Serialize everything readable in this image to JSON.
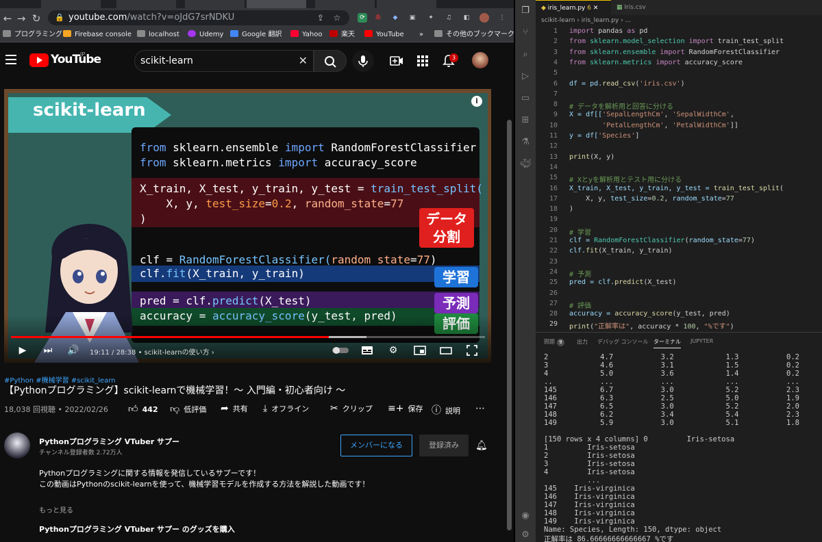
{
  "browser": {
    "url_host": "youtube.com",
    "url_path": "/watch?v=oJdG7srNDKU",
    "bookmarks": [
      {
        "label": "プログラミング",
        "color": "#8a8a8a"
      },
      {
        "label": "Firebase console",
        "color": "#f6a623"
      },
      {
        "label": "localhost",
        "color": "#8a8a8a"
      },
      {
        "label": "Udemy",
        "color": "#a435f0"
      },
      {
        "label": "Google 翻訳",
        "color": "#4285f4"
      },
      {
        "label": "Yahoo",
        "color": "#ff0033"
      },
      {
        "label": "楽天",
        "color": "#bf0000"
      },
      {
        "label": "YouTube",
        "color": "#ff0000"
      },
      {
        "label": "»",
        "color": ""
      },
      {
        "label": "その他のブックマーク",
        "color": "#8a8a8a"
      }
    ]
  },
  "youtube": {
    "logo_text": "YouTube",
    "logo_region": "JP",
    "search_value": "scikit-learn",
    "notification_count": "3",
    "video": {
      "banner": "scikit-learn",
      "code_lines": {
        "l1a": "from",
        "l1b": " sklearn.ensemble ",
        "l1c": "import",
        "l1d": " RandomForestClassifier",
        "l2a": "from",
        "l2b": " sklearn.metrics ",
        "l2c": "import",
        "l2d": " accuracy_score",
        "l3a": "X_train, X_test, y_train, y_test = ",
        "l3b": "train_test_split(",
        "l4a": "    X, y, ",
        "l4b": "test_size",
        "l4c": "=",
        "l4d": "0.2",
        "l4e": ", ",
        "l4f": "random_state",
        "l4g": "=",
        "l4h": "77",
        "l5": ")",
        "l6a": "clf = ",
        "l6b": "RandomForestClassifier(",
        "l6c": "random_state",
        "l6d": "=",
        "l6e": "77",
        "l6f": ")",
        "l7a": "clf.",
        "l7b": "fit",
        "l7c": "(X_train, y_train)",
        "l8a": "pred = clf.",
        "l8b": "predict",
        "l8c": "(X_test)",
        "l9a": "accuracy = ",
        "l9b": "accuracy_score",
        "l9c": "(y_test, pred)"
      },
      "tags": {
        "split1": "データ",
        "split2": "分割",
        "learn": "学習",
        "predict": "予測",
        "evaluate": "評価"
      },
      "current_time": "19:11",
      "duration": "28:38",
      "chapter": "scikit-learnの使い方",
      "played_fraction": 0.67
    },
    "hashtags": "#Python #機械学習 #scikit_learn",
    "title": "【Pythonプログラミング】scikit-learnで機械学習！〜 入門編・初心者向け 〜",
    "views": "18,038 回視聴",
    "date": "2022/02/26",
    "actions": {
      "likes": "442",
      "dislike": "低評価",
      "share": "共有",
      "offline": "オフライン",
      "clip": "クリップ",
      "save": "保存",
      "explain": "説明"
    },
    "channel": {
      "name": "Pythonプログラミング VTuber サプー",
      "subscribers": "チャンネル登録者数 2.72万人",
      "join": "メンバーになる",
      "subscribed": "登録済み"
    },
    "description": [
      "Pythonプログラミングに関する情報を発信しているサプーです！",
      "この動画はPythonのscikit-learnを使って、機械学習モデルを作成する方法を解説した動画です！"
    ],
    "show_more": "もっと見る",
    "merch": "Pythonプログラミング VTuber サプー のグッズを購入"
  },
  "vscode": {
    "tabs": [
      {
        "label": "iris_learn.py",
        "badge": "6",
        "active": true
      },
      {
        "label": "Iris.csv",
        "active": false
      }
    ],
    "breadcrumb": "scikit-learn  ›  iris_learn.py  ›  ...",
    "code": {
      "1a": "import",
      "1b": " pandas ",
      "1c": "as",
      "1d": " pd",
      "2a": "from",
      "2b": " sklearn.model_selection ",
      "2c": "import",
      "2d": " train_test_split",
      "3a": "from",
      "3b": " sklearn.ensemble ",
      "3c": "import",
      "3d": " RandomForestClassifier",
      "4a": "from",
      "4b": " sklearn.metrics ",
      "4c": "import",
      "4d": " accuracy_score",
      "6a": "df = pd.",
      "6b": "read_csv",
      "6c": "(",
      "6d": "'iris.csv'",
      "6e": ")",
      "8": "# データを解析用と回答に分ける",
      "9a": "X = df[[",
      "9b": "'SepalLengthCm'",
      "9c": ", ",
      "9d": "'SepalWidthCm'",
      "9e": ",",
      "10a": "        ",
      "10b": "'PetalLengthCm'",
      "10c": ", ",
      "10d": "'PetalWidthCm'",
      "10e": "]]",
      "11a": "y = df[",
      "11b": "'Species'",
      "11c": "]",
      "13a": "print",
      "13b": "(X, y)",
      "15": "# Xとyを解析用とテスト用に分ける",
      "16a": "X_train, X_test, y_train, y_test = ",
      "16b": "train_test_split",
      "16c": "(",
      "17a": "    X, y, ",
      "17b": "test_size",
      "17c": "=",
      "17d": "0.2",
      "17e": ", ",
      "17f": "random_state",
      "17g": "=",
      "17h": "77",
      "18": ")",
      "20": "# 学習",
      "21a": "clf = ",
      "21b": "RandomForestClassifier",
      "21c": "(",
      "21d": "random_state",
      "21e": "=",
      "21f": "77",
      "21g": ")",
      "22a": "clf.",
      "22b": "fit",
      "22c": "(X_train, y_train)",
      "24": "# 予測",
      "25a": "pred = clf.",
      "25b": "predict",
      "25c": "(X_test)",
      "27": "# 評価",
      "28a": "accuracy = ",
      "28b": "accuracy_score",
      "28c": "(y_test, pred)",
      "29a": "print",
      "29b": "(",
      "29c": "\"正解率は\"",
      "29d": ", accuracy * ",
      "29e": "100",
      "29f": ", ",
      "29g": "\"%です\"",
      "29h": ")"
    },
    "line_numbers": [
      "1",
      "2",
      "3",
      "4",
      "5",
      "6",
      "7",
      "8",
      "9",
      "10",
      "11",
      "12",
      "13",
      "14",
      "15",
      "16",
      "17",
      "18",
      "19",
      "20",
      "21",
      "22",
      "23",
      "24",
      "25",
      "26",
      "27",
      "28",
      "29"
    ],
    "panel_tabs": {
      "problems": "問題",
      "problems_count": "9",
      "output": "出力",
      "debug": "デバッグ コンソール",
      "terminal": "ターミナル",
      "jupyter": "JUPYTER"
    },
    "terminal_lines": [
      "2            4.7           3.2            1.3           0.2",
      "3            4.6           3.1            1.5           0.2",
      "4            5.0           3.6            1.4           0.2",
      "..           ...           ...            ...           ...",
      "145          6.7           3.0            5.2           2.3",
      "146          6.3           2.5            5.0           1.9",
      "147          6.5           3.0            5.2           2.0",
      "148          6.2           3.4            5.4           2.3",
      "149          5.9           3.0            5.1           1.8",
      "",
      "[150 rows x 4 columns] 0         Iris-setosa",
      "1         Iris-setosa",
      "2         Iris-setosa",
      "3         Iris-setosa",
      "4         Iris-setosa",
      "          ...",
      "145    Iris-virginica",
      "146    Iris-virginica",
      "147    Iris-virginica",
      "148    Iris-virginica",
      "149    Iris-virginica",
      "Name: Species, Length: 150, dtype: object",
      "正解率は 86.66666666666667 %です"
    ]
  }
}
